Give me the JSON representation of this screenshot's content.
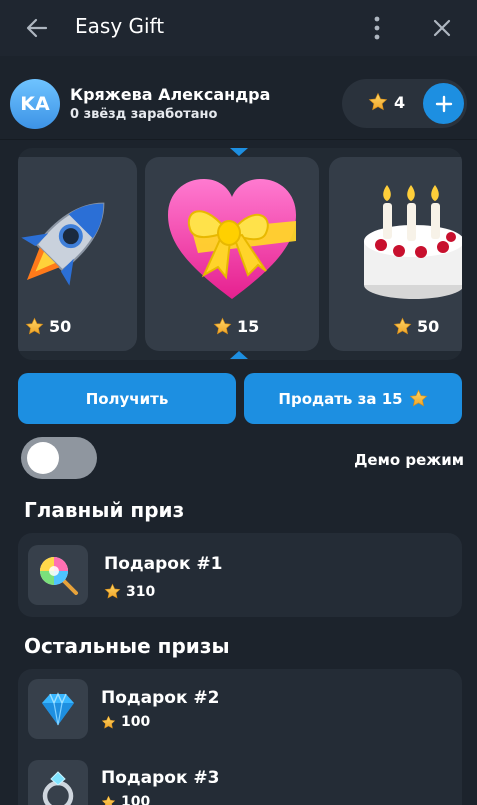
{
  "header": {
    "title": "Easy Gift"
  },
  "user": {
    "initials": "KA",
    "name": "Кряжева Александра",
    "subtitle": "0 звёзд заработано",
    "balance": "4"
  },
  "carousel": {
    "items": [
      {
        "icon": "rocket-icon",
        "price": "50"
      },
      {
        "icon": "heart-gift-icon",
        "price": "15"
      },
      {
        "icon": "cake-icon",
        "price": "50"
      }
    ]
  },
  "actions": {
    "receive_label": "Получить",
    "sell_label": "Продать за 15"
  },
  "demo": {
    "label": "Демо режим",
    "enabled": false
  },
  "main_prize": {
    "title": "Главный приз",
    "items": [
      {
        "icon": "lollipop-icon",
        "name": "Подарок #1",
        "price": "310"
      }
    ]
  },
  "other_prizes": {
    "title": "Остальные призы",
    "items": [
      {
        "icon": "diamond-icon",
        "name": "Подарок #2",
        "price": "100"
      },
      {
        "icon": "ring-icon",
        "name": "Подарок #3",
        "price": "100"
      }
    ]
  },
  "colors": {
    "background": "#1c232c",
    "accent": "#1d8fe1",
    "card": "#343d48",
    "star": "#f5b82e"
  }
}
